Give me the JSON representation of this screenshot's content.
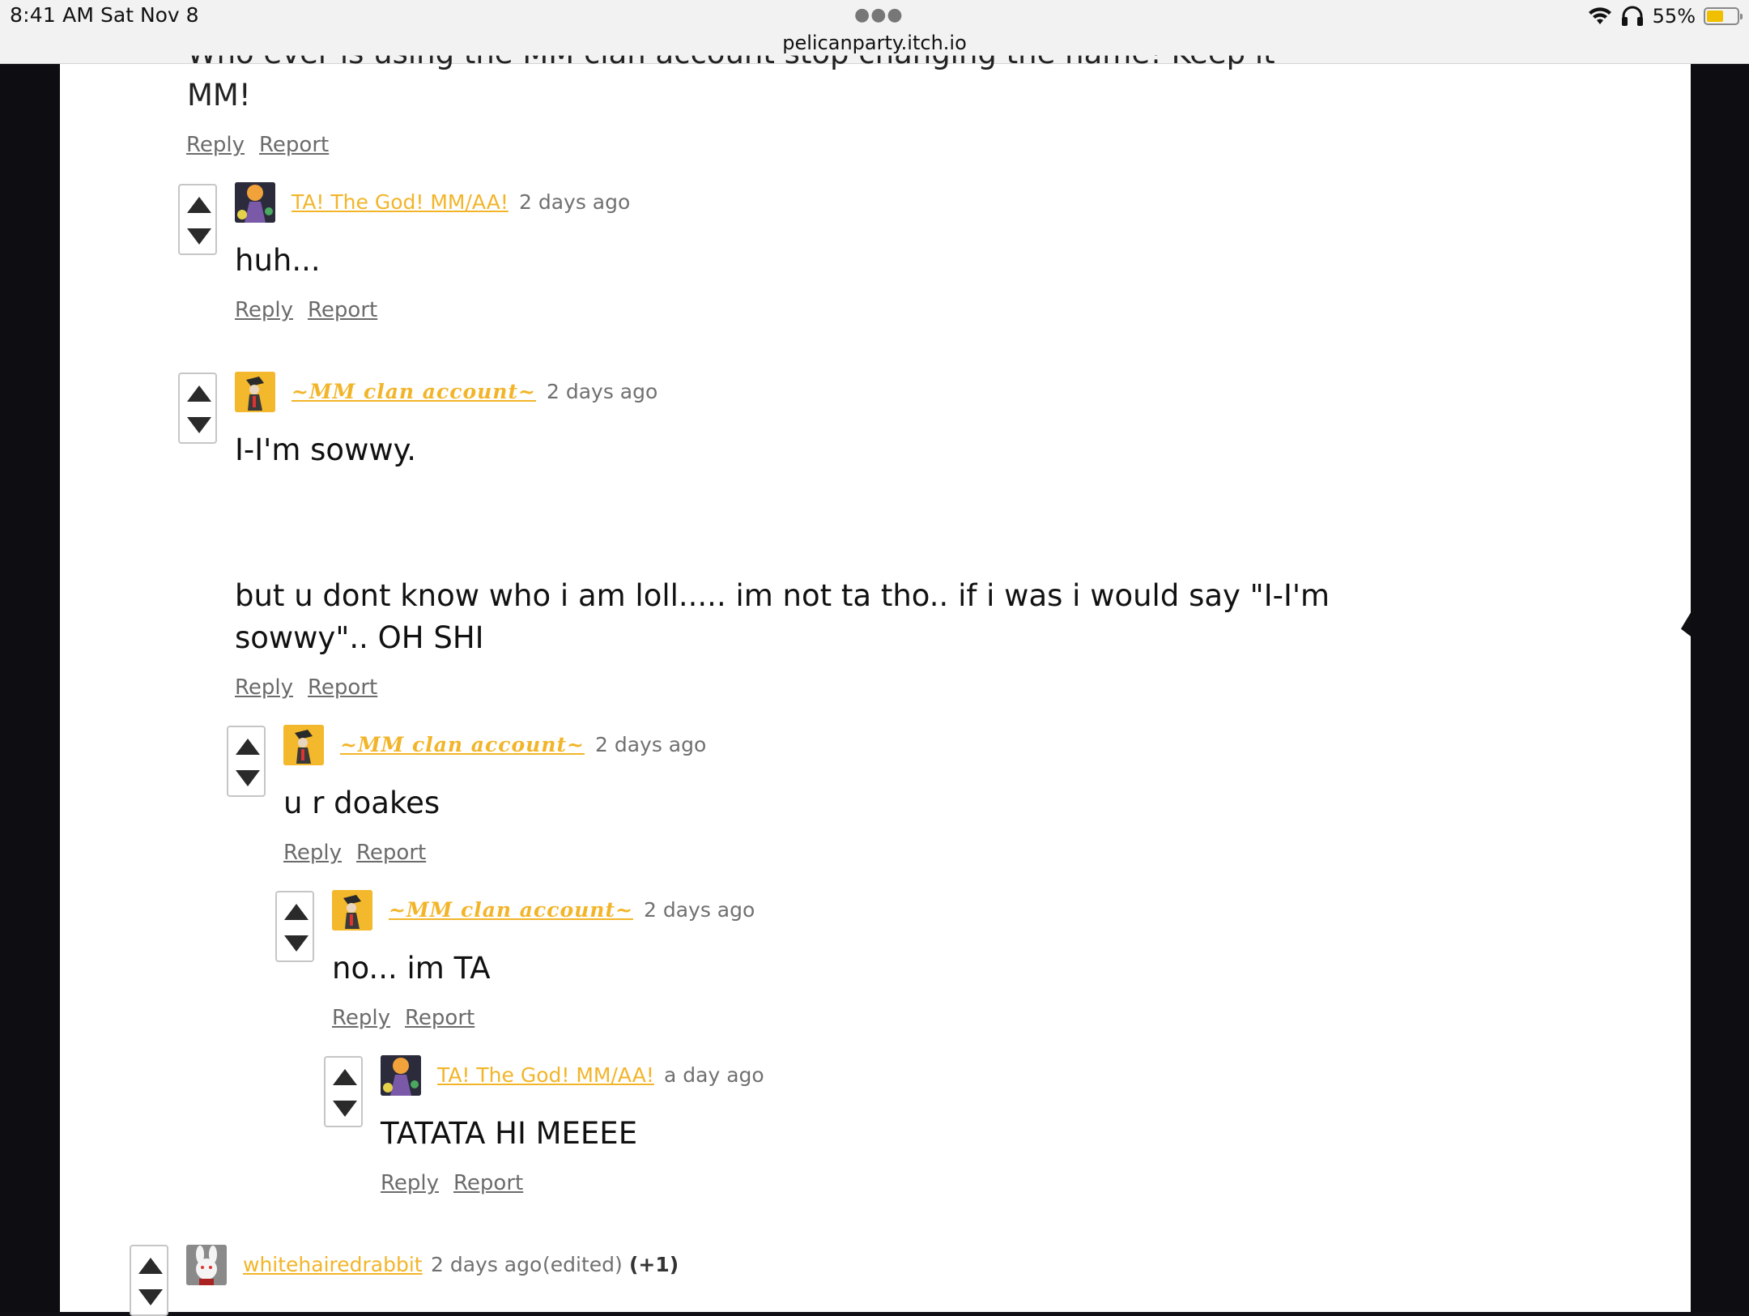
{
  "status_bar": {
    "time": "8:41 AM",
    "date": "Sat Nov 8",
    "url": "pelicanparty.itch.io",
    "battery_percent": "55%",
    "battery_level": 0.55
  },
  "top_comment": {
    "partial_text_line1": "Who ever is using the MM clan account stop changing the name! Keep it",
    "text_line2": "MM!",
    "reply_label": "Reply",
    "report_label": "Report"
  },
  "comments": [
    {
      "author": "TA! The God! MM/AA!",
      "time": "2 days ago",
      "body": [
        "huh..."
      ],
      "reply_label": "Reply",
      "report_label": "Report"
    },
    {
      "author": "~MM clan account~",
      "time": "2 days ago",
      "body": [
        "I-I'm sowwy.",
        "but u dont know who i am loll..... im not ta tho.. if i was i would say \"I-I'm",
        "sowwy\".. OH SHI"
      ],
      "reply_label": "Reply",
      "report_label": "Report"
    },
    {
      "author": "~MM clan account~",
      "time": "2 days ago",
      "body": [
        "u r doakes"
      ],
      "reply_label": "Reply",
      "report_label": "Report"
    },
    {
      "author": "~MM clan account~",
      "time": "2 days ago",
      "body": [
        "no... im TA"
      ],
      "reply_label": "Reply",
      "report_label": "Report"
    },
    {
      "author": "TA! The God! MM/AA!",
      "time": "a day ago",
      "body": [
        "TATATA HI MEEEE"
      ],
      "reply_label": "Reply",
      "report_label": "Report"
    },
    {
      "author": "whitehairedrabbit",
      "time": "2 days ago",
      "edited": "(edited)",
      "score": "(+1)"
    }
  ],
  "icons": {
    "upvote": "triangle-up",
    "downvote": "triangle-down",
    "wifi": "wifi-icon",
    "headphones": "headphones-icon",
    "battery": "battery-icon"
  }
}
